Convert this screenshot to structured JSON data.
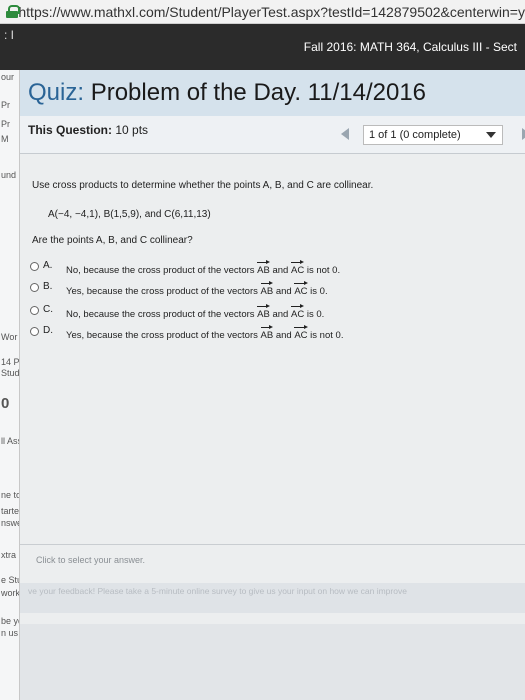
{
  "browser": {
    "url": "https://www.mathxl.com/Student/PlayerTest.aspx?testId=142879502&centerwin=y"
  },
  "course": {
    "left_fragment": ": I",
    "title": "Fall 2016: MATH 364, Calculus III - Sect"
  },
  "sidebar_fragments": [
    "our",
    "Pr",
    "Pr",
    "M",
    "und",
    "Wor",
    "14 P",
    "Stud",
    "0",
    "ll Ass",
    "ne to",
    "tarted",
    "nswer",
    "xtra h",
    "e Stud",
    "work",
    "be yo",
    "n us"
  ],
  "quiz": {
    "label": "Quiz:",
    "title": "Problem of the Day. 11/14/2016"
  },
  "question_bar": {
    "this_question_label": "This Question:",
    "points": "10 pts",
    "progress": "1 of 1 (0 complete)"
  },
  "question": {
    "instruction": "Use cross products to determine whether the points A, B, and C are collinear.",
    "points": "A(−4, −4,1), B(1,5,9), and C(6,11,13)",
    "prompt": "Are the points A, B, and C collinear?",
    "options": [
      {
        "letter": "A.",
        "pre": "No, because the cross product of the vectors ",
        "v1": "AB",
        "mid": " and ",
        "v2": "AC",
        "post": " is not 0."
      },
      {
        "letter": "B.",
        "pre": "Yes, because the cross product of the vectors ",
        "v1": "AB",
        "mid": " and ",
        "v2": "AC",
        "post": " is 0."
      },
      {
        "letter": "C.",
        "pre": "No, because the cross product of the vectors ",
        "v1": "AB",
        "mid": " and ",
        "v2": "AC",
        "post": " is 0."
      },
      {
        "letter": "D.",
        "pre": "Yes, because the cross product of the vectors ",
        "v1": "AB",
        "mid": " and ",
        "v2": "AC",
        "post": " is not 0."
      }
    ]
  },
  "hint": "Click to select your answer.",
  "feedback": "ve your feedback! Please take a 5-minute online survey to give us your input on how we can improve"
}
